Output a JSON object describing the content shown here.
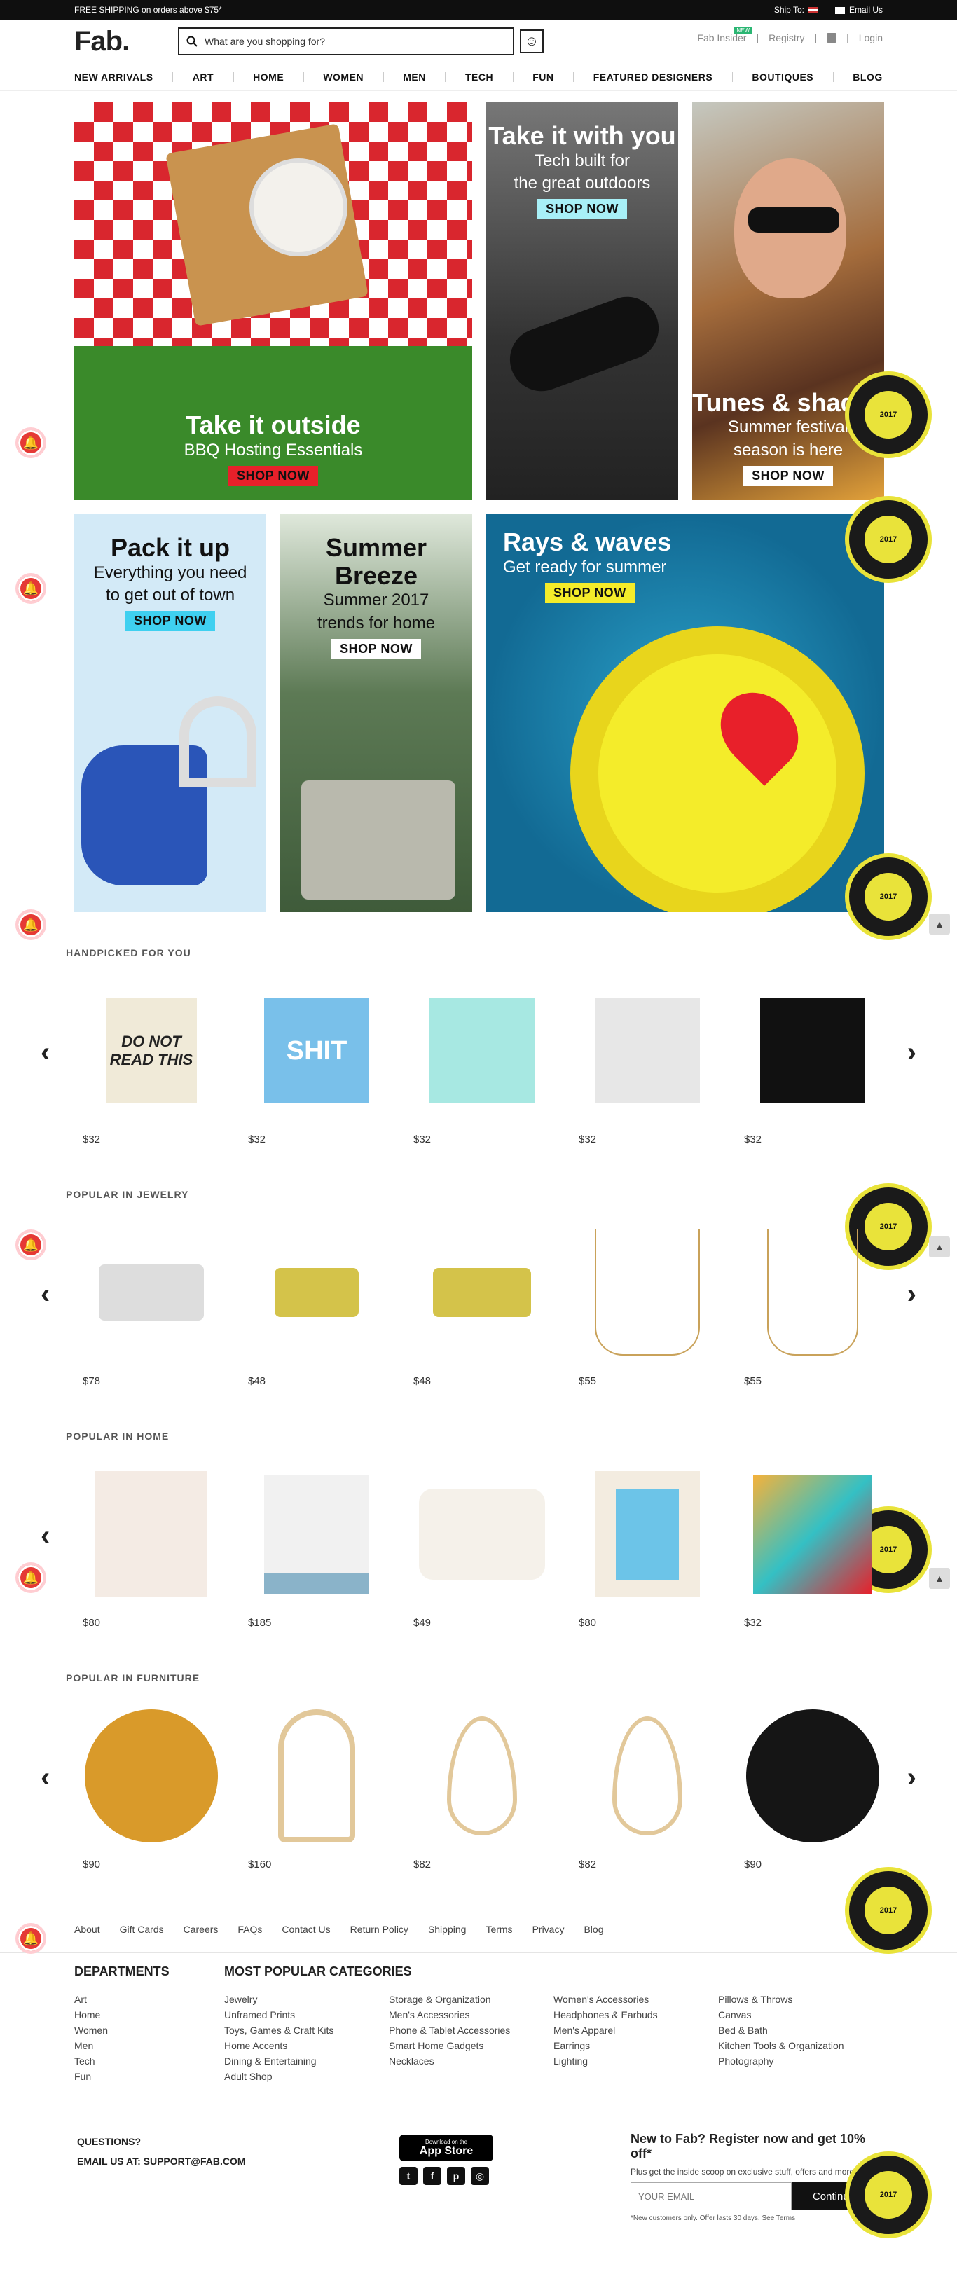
{
  "topbar": {
    "shipping_text": "FREE SHIPPING on orders above $75*",
    "ship_to": "Ship To:",
    "email_us": "Email Us"
  },
  "header": {
    "logo": "Fab.",
    "search_placeholder": "What are you shopping for?",
    "insider": "Fab Insider",
    "new_badge": "NEW",
    "registry": "Registry",
    "login": "Login"
  },
  "nav": [
    "NEW ARRIVALS",
    "ART",
    "HOME",
    "WOMEN",
    "MEN",
    "TECH",
    "FUN",
    "FEATURED DESIGNERS",
    "BOUTIQUES",
    "BLOG"
  ],
  "banners": {
    "picnic": {
      "title": "Take it outside",
      "sub": "BBQ Hosting Essentials",
      "cta": "SHOP NOW"
    },
    "tech": {
      "title": "Take it with you",
      "sub1": "Tech built for",
      "sub2": "the great outdoors",
      "cta": "SHOP NOW"
    },
    "tunes": {
      "title": "Tunes & shades",
      "sub1": "Summer festival",
      "sub2": "season is here",
      "cta": "SHOP NOW"
    },
    "pack": {
      "title": "Pack it up",
      "sub1": "Everything you need",
      "sub2": "to get out of town",
      "cta": "SHOP NOW"
    },
    "breeze": {
      "title1": "Summer",
      "title2": "Breeze",
      "sub1": "Summer 2017",
      "sub2": "trends for home",
      "cta": "SHOP NOW"
    },
    "rays": {
      "title": "Rays & waves",
      "sub": "Get ready for summer",
      "cta": "SHOP NOW"
    }
  },
  "award": {
    "label": "2017"
  },
  "sections": [
    {
      "title": "HANDPICKED FOR YOU",
      "products": [
        {
          "price": "$32",
          "caption": "DO NOT READ THIS"
        },
        {
          "price": "$32",
          "caption": "SHIT"
        },
        {
          "price": "$32",
          "caption": ""
        },
        {
          "price": "$32",
          "caption": ""
        },
        {
          "price": "$32",
          "caption": ""
        }
      ]
    },
    {
      "title": "POPULAR IN JEWELRY",
      "products": [
        {
          "price": "$78"
        },
        {
          "price": "$48"
        },
        {
          "price": "$48"
        },
        {
          "price": "$55"
        },
        {
          "price": "$55"
        }
      ]
    },
    {
      "title": "POPULAR IN HOME",
      "products": [
        {
          "price": "$80"
        },
        {
          "price": "$185"
        },
        {
          "price": "$49"
        },
        {
          "price": "$80"
        },
        {
          "price": "$32"
        }
      ]
    },
    {
      "title": "POPULAR IN FURNITURE",
      "products": [
        {
          "price": "$90"
        },
        {
          "price": "$160"
        },
        {
          "price": "$82"
        },
        {
          "price": "$82"
        },
        {
          "price": "$90"
        }
      ]
    }
  ],
  "footer": {
    "links": [
      "About",
      "Gift Cards",
      "Careers",
      "FAQs",
      "Contact Us",
      "Return Policy",
      "Shipping",
      "Terms",
      "Privacy",
      "Blog"
    ],
    "departments_title": "DEPARTMENTS",
    "departments": [
      "Art",
      "Home",
      "Women",
      "Men",
      "Tech",
      "Fun"
    ],
    "categories_title": "MOST POPULAR CATEGORIES",
    "categories": [
      [
        "Jewelry",
        "Unframed Prints",
        "Toys, Games & Craft Kits",
        "Home Accents",
        "Dining & Entertaining",
        "Adult Shop"
      ],
      [
        "Storage & Organization",
        "Men's Accessories",
        "Phone & Tablet Accessories",
        "Smart Home Gadgets",
        "Necklaces"
      ],
      [
        "Women's Accessories",
        "Headphones & Earbuds",
        "Men's Apparel",
        "Earrings",
        "Lighting"
      ],
      [
        "Pillows & Throws",
        "Canvas",
        "Bed & Bath",
        "Kitchen Tools & Organization",
        "Photography"
      ]
    ],
    "questions": "QUESTIONS?",
    "email_line": "EMAIL US AT: SUPPORT@FAB.COM",
    "app_small": "Download on the",
    "app_big": "App Store",
    "register_title": "New to Fab? Register now and get 10% off*",
    "register_sub": "Plus get the inside scoop on exclusive stuff, offers and more",
    "email_placeholder": "YOUR EMAIL",
    "continue_btn": "Continue",
    "fine_print": "*New customers only. Offer lasts 30 days. See Terms"
  },
  "colors": {
    "accent_red": "#e8202a",
    "cyan_cta": "#3fd0f0",
    "award_yellow": "#e9e33a"
  }
}
